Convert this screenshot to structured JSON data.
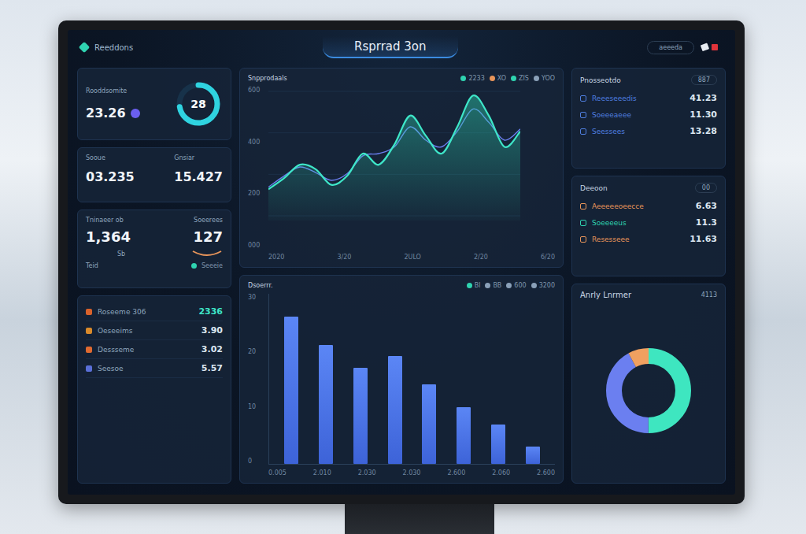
{
  "header": {
    "logo": "Reeddons",
    "title": "Rsprrad 3on",
    "pill": "aeeeda"
  },
  "kpi": {
    "label": "Rooddsomite",
    "value": "23.26",
    "gauge": "28",
    "level": 0.72
  },
  "pair": [
    {
      "label": "Sooue",
      "value": "03.235"
    },
    {
      "label": "Gnsiar",
      "value": "15.427"
    }
  ],
  "trend": {
    "labels": [
      "Tninaeer ob",
      "Soeerees"
    ],
    "values": [
      "1,364",
      "127"
    ],
    "note": "Sb",
    "foot": "Teid",
    "tag": "Seeeie"
  },
  "list": [
    {
      "label": "Roseeme 306",
      "value": "2336",
      "color": "#d9622b"
    },
    {
      "label": "Oeseeims",
      "value": "3.90",
      "color": "#d98a2b"
    },
    {
      "label": "Dessseme",
      "value": "3.02",
      "color": "#e06a30"
    },
    {
      "label": "Seesoe",
      "value": "5.57",
      "color": "#5a6fd8"
    }
  ],
  "line_chart": {
    "title": "Snpprodaals",
    "legend": [
      {
        "label": "2233",
        "color": "#2fd3b0"
      },
      {
        "label": "XO",
        "color": "#e8955a"
      },
      {
        "label": "ZIS",
        "color": "#2fd3b0"
      },
      {
        "label": "YOO",
        "color": "#8aa0b8"
      }
    ],
    "y_ticks": [
      "600",
      "400",
      "200",
      "000"
    ],
    "x_ticks": [
      "2020",
      "3/20",
      "2ULO",
      "2/20",
      "6/20"
    ],
    "series": [
      {
        "values": [
          140,
          190,
          250,
          230,
          160,
          200,
          300,
          250,
          340,
          470,
          380,
          300,
          420,
          560,
          470,
          330,
          400
        ],
        "color": "#3ee6c8"
      },
      {
        "values": [
          150,
          200,
          240,
          215,
          180,
          210,
          290,
          300,
          330,
          420,
          360,
          330,
          400,
          500,
          440,
          360,
          410
        ],
        "color": "#6b7ff0"
      }
    ]
  },
  "bar_chart": {
    "title": "Dsoerrr.",
    "legend": [
      {
        "label": "Bl",
        "color": "#2fd3b0"
      },
      {
        "label": "BB",
        "color": "#8aa0b8"
      },
      {
        "label": "600",
        "color": "#8aa0b8"
      },
      {
        "label": "3200",
        "color": "#8aa0b8"
      }
    ],
    "y_ticks": [
      "30",
      "20",
      "10",
      "0"
    ],
    "values": [
      26,
      21,
      17,
      19,
      14,
      10,
      7,
      3
    ],
    "x_ticks": [
      "0.005",
      "2.010",
      "2.030",
      "2.030",
      "2.600",
      "2.060",
      "2.600"
    ]
  },
  "panel_a": {
    "title": "Pnosseotdo",
    "badge": "887",
    "rows": [
      {
        "label": "Reeeseeedis",
        "value": "41.23",
        "color": "#4f7fe0"
      },
      {
        "label": "Soeeeaeee",
        "value": "11.30",
        "color": "#4f7fe0"
      },
      {
        "label": "Seessees",
        "value": "13.28",
        "color": "#4f7fe0"
      }
    ]
  },
  "panel_b": {
    "title": "Deeoon",
    "badge": "00",
    "rows": [
      {
        "label": "Aeeeeeoeecce",
        "value": "6.63",
        "color": "#e8955a"
      },
      {
        "label": "Soeeeeus",
        "value": "11.3",
        "color": "#2fd3b0"
      },
      {
        "label": "Resesseee",
        "value": "11.63",
        "color": "#e8955a"
      }
    ]
  },
  "donut": {
    "title": "Anrly Lnrmer",
    "badge": "4113",
    "segments": [
      {
        "value": 50,
        "color": "#3ee6c0"
      },
      {
        "value": 42,
        "color": "#6b7ff0"
      },
      {
        "value": 8,
        "color": "#f0a060"
      }
    ]
  }
}
